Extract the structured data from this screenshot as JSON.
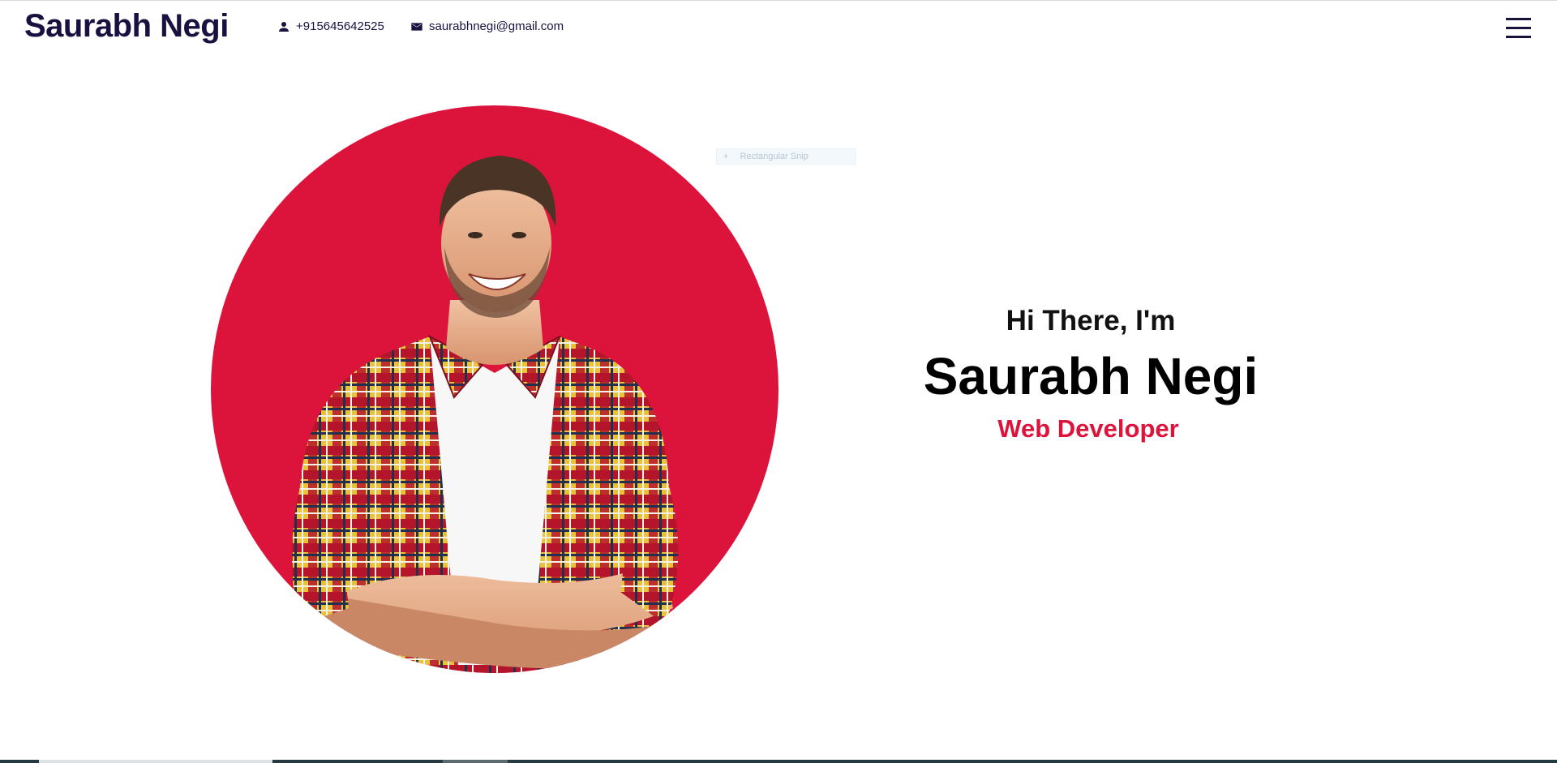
{
  "header": {
    "brand": "Saurabh Negi",
    "phone": "+915645642525",
    "email": "saurabhnegi@gmail.com",
    "phone_icon": "person-icon",
    "email_icon": "mail-icon",
    "menu_icon": "hamburger-menu-icon"
  },
  "hero": {
    "greeting": "Hi There, I'm",
    "name": "Saurabh Negi",
    "role": "Web Developer",
    "accent_color": "#dc143c",
    "text_color": "#1a1140"
  },
  "overlay": {
    "snip_label": "Rectangular Snip",
    "snip_icon": "+"
  }
}
